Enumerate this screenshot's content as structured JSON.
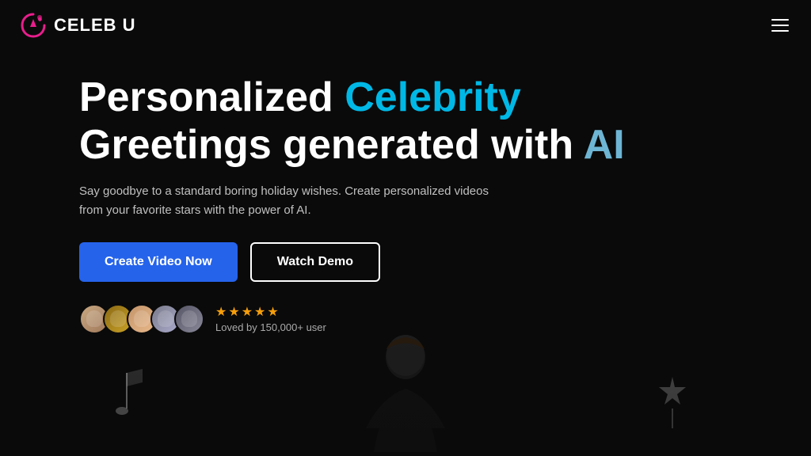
{
  "header": {
    "logo_text": "CELEB U",
    "menu_icon_label": "Menu"
  },
  "hero": {
    "headline_part1": "Personalized ",
    "headline_accent1": "Celebrity",
    "headline_line2_part1": "Greetings generated with ",
    "headline_accent2": "AI",
    "subtext": "Say goodbye to a standard boring holiday wishes. Create personalized videos from your favorite stars with the power of AI.",
    "cta_primary": "Create Video Now",
    "cta_secondary": "Watch Demo",
    "social_proof": {
      "stars": 5,
      "loved_text": "Loved by 150,000+ user"
    }
  },
  "colors": {
    "bg": "#0a0a0a",
    "accent_cyan": "#00b8e6",
    "accent_blue": "#6eb5d4",
    "btn_primary_bg": "#2563eb",
    "star_color": "#f59e0b"
  }
}
